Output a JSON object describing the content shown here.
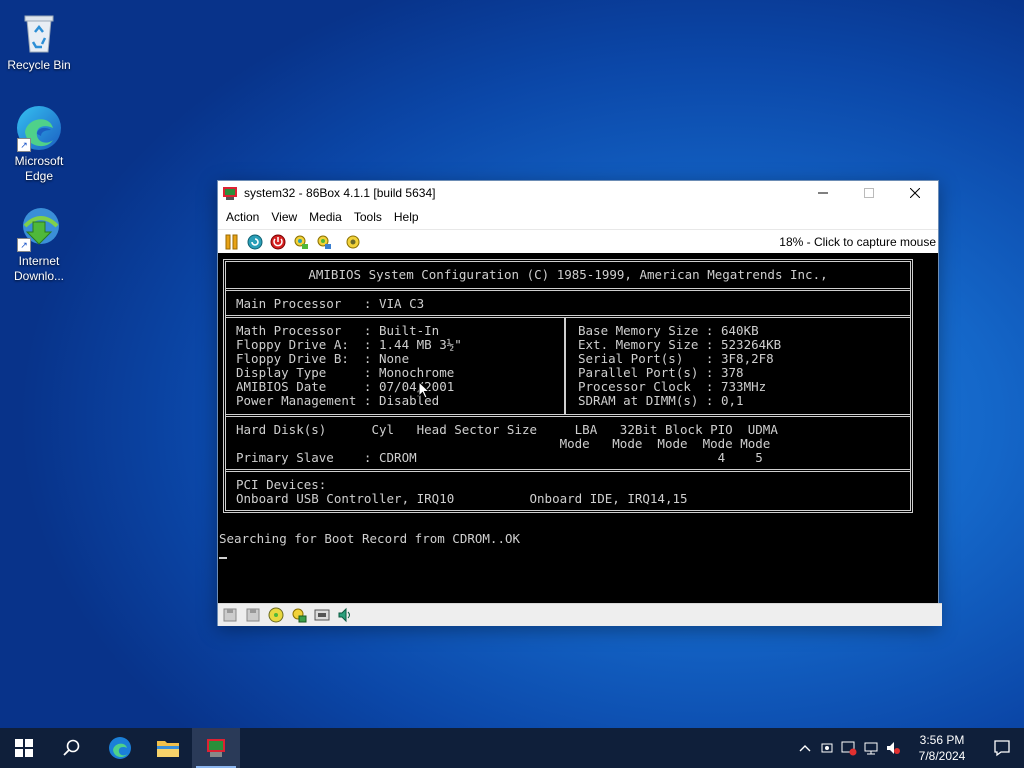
{
  "desktop": {
    "icons": [
      {
        "label": "Recycle Bin"
      },
      {
        "label": "Microsoft Edge"
      },
      {
        "label": "Internet Downlo..."
      }
    ]
  },
  "window": {
    "title": "system32 - 86Box 4.1.1 [build 5634]",
    "menu": [
      "Action",
      "View",
      "Media",
      "Tools",
      "Help"
    ],
    "capture_text": "18% - Click to capture mouse"
  },
  "bios": {
    "header": "AMIBIOS System Configuration (C) 1985-1999, American Megatrends Inc.,",
    "main_processor": "Main Processor   : VIA C3",
    "left_block": "Math Processor   : Built-In\nFloppy Drive A:  : 1.44 MB 3½\"\nFloppy Drive B:  : None\nDisplay Type     : Monochrome\nAMIBIOS Date     : 07/04/2001\nPower Management : Disabled",
    "right_block": "Base Memory Size : 640KB\nExt. Memory Size : 523264KB\nSerial Port(s)   : 3F8,2F8\nParallel Port(s) : 378\nProcessor Clock  : 733MHz\nSDRAM at DIMM(s) : 0,1",
    "disk_block": "Hard Disk(s)      Cyl   Head Sector Size     LBA   32Bit Block PIO  UDMA\n                                           Mode   Mode  Mode  Mode Mode\nPrimary Slave    : CDROM                                        4    5",
    "pci_block": "PCI Devices:\nOnboard USB Controller, IRQ10          Onboard IDE, IRQ14,15",
    "boot_line": "Searching for Boot Record from CDROM..OK"
  },
  "taskbar": {
    "time": "3:56 PM",
    "date": "7/8/2024"
  }
}
